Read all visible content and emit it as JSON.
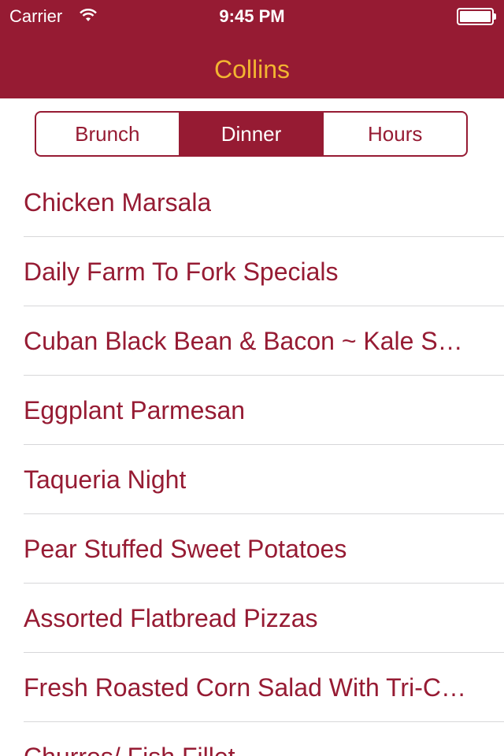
{
  "status_bar": {
    "carrier": "Carrier",
    "time": "9:45 PM",
    "icons": [
      "wifi-icon",
      "battery-icon"
    ]
  },
  "nav": {
    "title": "Collins"
  },
  "segments": [
    {
      "label": "Brunch",
      "selected": false
    },
    {
      "label": "Dinner",
      "selected": true
    },
    {
      "label": "Hours",
      "selected": false
    }
  ],
  "menu_items": [
    "Chicken Marsala",
    "Daily Farm To Fork Specials",
    "Cuban Black Bean & Bacon ~ Kale Soup",
    "Eggplant Parmesan",
    "Taqueria Night",
    "Pear Stuffed Sweet Potatoes",
    "Assorted Flatbread Pizzas",
    "Fresh Roasted Corn Salad With Tri-Color Quinoa",
    "Churros/ Fish Fillet"
  ],
  "colors": {
    "brand": "#961b33",
    "title": "#f2b531",
    "separator": "#d7d7d9",
    "background": "#ffffff"
  }
}
